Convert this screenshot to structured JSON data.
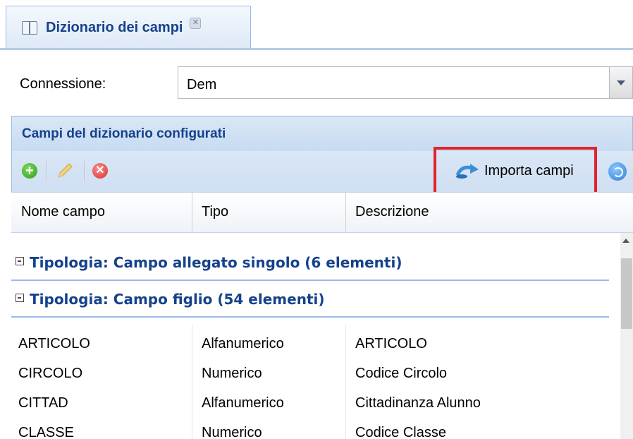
{
  "tab": {
    "title": "Dizionario dei campi",
    "close_icon": "close-icon"
  },
  "connection": {
    "label": "Connessione:",
    "value": "Dem"
  },
  "panel": {
    "title": "Campi del dizionario configurati"
  },
  "toolbar": {
    "import_label": "Importa campi",
    "icons": [
      "add-icon",
      "edit-icon",
      "delete-icon",
      "import-icon",
      "refresh-icon"
    ]
  },
  "grid": {
    "columns": [
      "Nome campo",
      "Tipo",
      "Descrizione"
    ],
    "groups": [
      "Tipologia: Campo allegato singolo (6 elementi)",
      "Tipologia: Campo figlio (54 elementi)"
    ],
    "rows": [
      {
        "name": "ARTICOLO",
        "type": "Alfanumerico",
        "desc": "ARTICOLO"
      },
      {
        "name": "CIRCOLO",
        "type": "Numerico",
        "desc": "Codice Circolo"
      },
      {
        "name": "CITTAD",
        "type": "Alfanumerico",
        "desc": "Cittadinanza Alunno"
      },
      {
        "name": "CLASSE",
        "type": "Numerico",
        "desc": "Codice Classe"
      }
    ]
  },
  "colors": {
    "accent": "#15428b",
    "highlight": "#e0242c"
  }
}
